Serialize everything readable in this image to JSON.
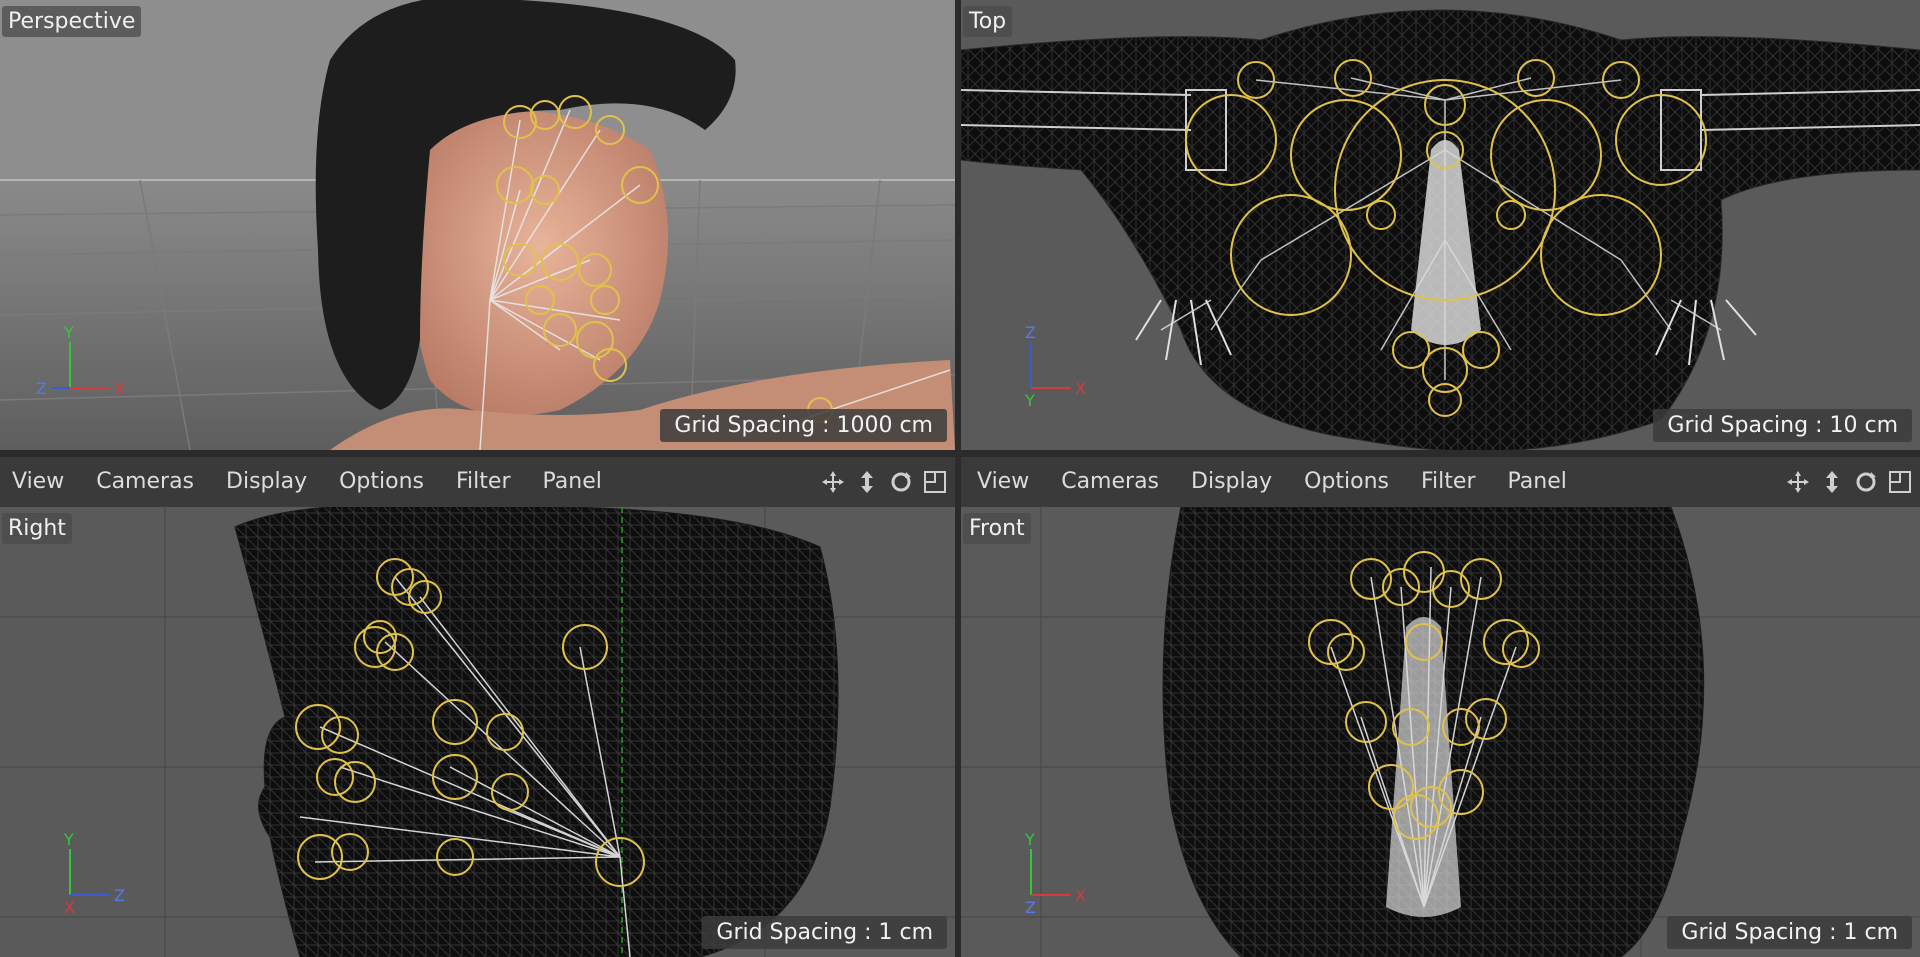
{
  "viewports": {
    "perspective": {
      "label": "Perspective",
      "grid": "Grid Spacing : 1000 cm"
    },
    "top": {
      "label": "Top",
      "grid": "Grid Spacing : 10 cm"
    },
    "right": {
      "label": "Right",
      "grid": "Grid Spacing : 1 cm"
    },
    "front": {
      "label": "Front",
      "grid": "Grid Spacing : 1 cm"
    }
  },
  "menus": {
    "left": [
      "View",
      "Cameras",
      "Display",
      "Options",
      "Filter",
      "Panel"
    ],
    "right": [
      "View",
      "Cameras",
      "Display",
      "Options",
      "Filter",
      "Panel"
    ]
  },
  "tools": [
    "move-view-icon",
    "dolly-view-icon",
    "rotate-view-icon",
    "maximize-view-icon"
  ],
  "axes": {
    "perspective": [
      "Y",
      "Z",
      "X"
    ],
    "top": [
      "Z",
      "Y",
      "X"
    ],
    "right": [
      "Y",
      "X",
      "Z"
    ],
    "front": [
      "Y",
      "Z",
      "X"
    ]
  },
  "colors": {
    "joint": "#e0c24a",
    "bone": "#e8e8e8",
    "axis_x": "#d23c3c",
    "axis_y": "#32c83c",
    "axis_z": "#3c5ad2"
  }
}
